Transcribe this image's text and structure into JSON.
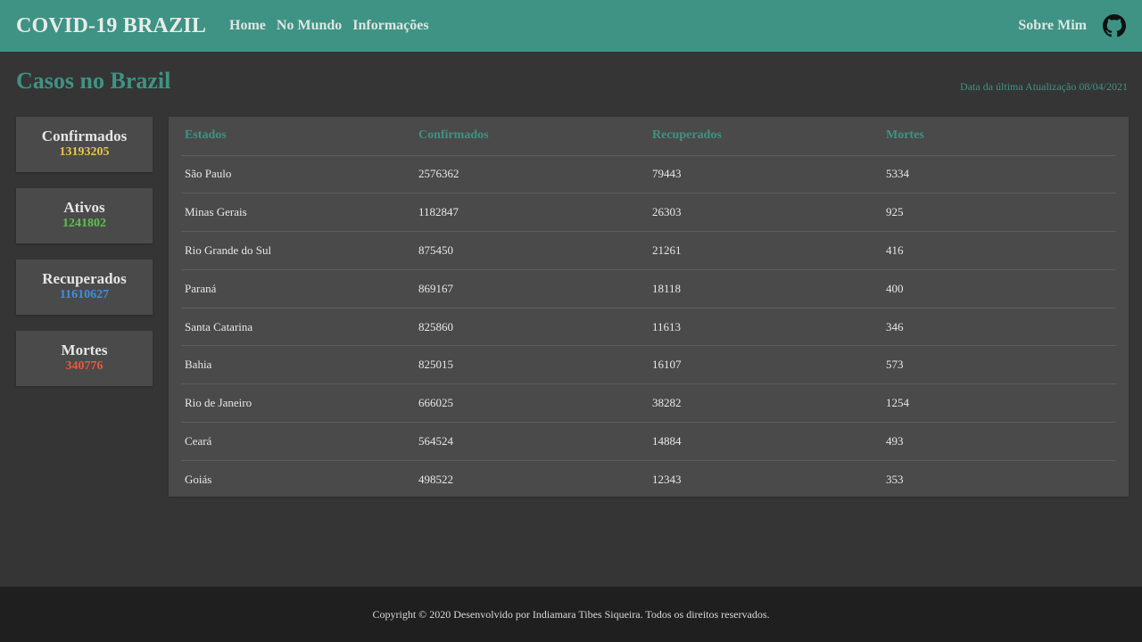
{
  "navbar": {
    "brand": "COVID-19 BRAZIL",
    "links": [
      "Home",
      "No Mundo",
      "Informações"
    ],
    "about": "Sobre Mim",
    "github_icon": "github-icon"
  },
  "page": {
    "title": "Casos no Brazil",
    "update_note": "Data da última Atualização 08/04/2021"
  },
  "cards": [
    {
      "title": "Confirmados",
      "value": "13193205",
      "color": "#e9c44b"
    },
    {
      "title": "Ativos",
      "value": "1241802",
      "color": "#5cc24b"
    },
    {
      "title": "Recuperados",
      "value": "11610627",
      "color": "#3d8fe6"
    },
    {
      "title": "Mortes",
      "value": "340776",
      "color": "#e8593c"
    }
  ],
  "table": {
    "headers": [
      "Estados",
      "Confirmados",
      "Recuperados",
      "Mortes"
    ],
    "rows": [
      [
        "São Paulo",
        "2576362",
        "79443",
        "5334"
      ],
      [
        "Minas Gerais",
        "1182847",
        "26303",
        "925"
      ],
      [
        "Rio Grande do Sul",
        "875450",
        "21261",
        "416"
      ],
      [
        "Paraná",
        "869167",
        "18118",
        "400"
      ],
      [
        "Santa Catarina",
        "825860",
        "11613",
        "346"
      ],
      [
        "Bahia",
        "825015",
        "16107",
        "573"
      ],
      [
        "Rio de Janeiro",
        "666025",
        "38282",
        "1254"
      ],
      [
        "Ceará",
        "564524",
        "14884",
        "493"
      ],
      [
        "Goiás",
        "498522",
        "12343",
        "353"
      ]
    ]
  },
  "footer": {
    "text": "Copyright © 2020 Desenvolvido por Indiamara Tibes Siqueira. Todos os direitos reservados."
  },
  "colors": {
    "accent": "#3e9384",
    "background": "#353535",
    "panel": "#4a4a4a",
    "footer": "#1f1f1f"
  }
}
